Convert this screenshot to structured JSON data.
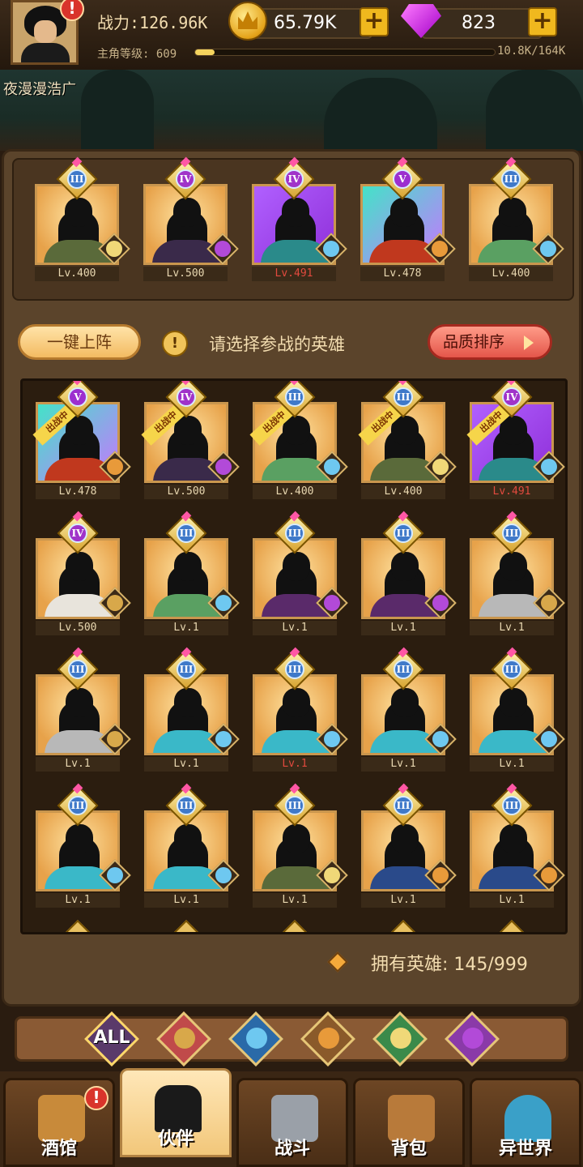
{
  "hud": {
    "power_label": "战力:126.96K",
    "level_label": "主角等级: 609",
    "exp_text": "10.8K/164K",
    "exp_fraction": 0.066,
    "gold": "65.79K",
    "gems": "823",
    "plus": "+",
    "alert": "!"
  },
  "scene": {
    "name": "夜漫漫浩广"
  },
  "lineup": [
    {
      "tier": "III",
      "level": "Lv.400",
      "red": false,
      "quality": "gold",
      "faction": "elf",
      "shoulder": "#5a6a3a"
    },
    {
      "tier": "IV",
      "level": "Lv.500",
      "red": false,
      "quality": "gold",
      "faction": "demon",
      "shoulder": "#3a2a4a"
    },
    {
      "tier": "IV",
      "level": "Lv.491",
      "red": true,
      "quality": "purple",
      "faction": "sea",
      "shoulder": "#2a8a8a"
    },
    {
      "tier": "V",
      "level": "Lv.478",
      "red": false,
      "quality": "rainbow",
      "faction": "beast",
      "shoulder": "#c0381e"
    },
    {
      "tier": "III",
      "level": "Lv.400",
      "red": false,
      "quality": "gold",
      "faction": "sea",
      "shoulder": "#5aa062"
    }
  ],
  "controls": {
    "auto_deploy": "一键上阵",
    "info_icon": "!",
    "hint": "请选择参战的英雄",
    "sort": "品质排序"
  },
  "roster": [
    {
      "tier": "V",
      "level": "Lv.478",
      "red": false,
      "quality": "rainbow",
      "faction": "beast",
      "shoulder": "#c0381e",
      "deployed": true
    },
    {
      "tier": "IV",
      "level": "Lv.500",
      "red": false,
      "quality": "gold",
      "faction": "demon",
      "shoulder": "#3a2a4a",
      "deployed": true
    },
    {
      "tier": "III",
      "level": "Lv.400",
      "red": false,
      "quality": "gold",
      "faction": "sea",
      "shoulder": "#5aa062",
      "deployed": true
    },
    {
      "tier": "III",
      "level": "Lv.400",
      "red": false,
      "quality": "gold",
      "faction": "elf",
      "shoulder": "#5a6a3a",
      "deployed": true
    },
    {
      "tier": "IV",
      "level": "Lv.491",
      "red": true,
      "quality": "purple",
      "faction": "sea",
      "shoulder": "#2a8a8a",
      "deployed": true
    },
    {
      "tier": "IV",
      "level": "Lv.500",
      "red": false,
      "quality": "gold",
      "faction": "human",
      "shoulder": "#e8e4dc",
      "deployed": false
    },
    {
      "tier": "III",
      "level": "Lv.1",
      "red": false,
      "quality": "gold",
      "faction": "sea",
      "shoulder": "#5aa062",
      "deployed": false
    },
    {
      "tier": "III",
      "level": "Lv.1",
      "red": false,
      "quality": "gold",
      "faction": "demon",
      "shoulder": "#5a2a6a",
      "deployed": false
    },
    {
      "tier": "III",
      "level": "Lv.1",
      "red": false,
      "quality": "gold",
      "faction": "demon",
      "shoulder": "#5a2a6a",
      "deployed": false
    },
    {
      "tier": "III",
      "level": "Lv.1",
      "red": false,
      "quality": "gold",
      "faction": "human",
      "shoulder": "#b8b8b8",
      "deployed": false
    },
    {
      "tier": "III",
      "level": "Lv.1",
      "red": false,
      "quality": "gold",
      "faction": "human",
      "shoulder": "#b8b8b8",
      "deployed": false
    },
    {
      "tier": "III",
      "level": "Lv.1",
      "red": false,
      "quality": "gold",
      "faction": "sea",
      "shoulder": "#3ab8c8",
      "deployed": false
    },
    {
      "tier": "III",
      "level": "Lv.1",
      "red": true,
      "quality": "gold",
      "faction": "sea",
      "shoulder": "#3ab8c8",
      "deployed": false
    },
    {
      "tier": "III",
      "level": "Lv.1",
      "red": false,
      "quality": "gold",
      "faction": "sea",
      "shoulder": "#3ab8c8",
      "deployed": false
    },
    {
      "tier": "III",
      "level": "Lv.1",
      "red": false,
      "quality": "gold",
      "faction": "sea",
      "shoulder": "#3ab8c8",
      "deployed": false
    },
    {
      "tier": "III",
      "level": "Lv.1",
      "red": false,
      "quality": "gold",
      "faction": "sea",
      "shoulder": "#3ab8c8",
      "deployed": false
    },
    {
      "tier": "III",
      "level": "Lv.1",
      "red": false,
      "quality": "gold",
      "faction": "sea",
      "shoulder": "#3ab8c8",
      "deployed": false
    },
    {
      "tier": "III",
      "level": "Lv.1",
      "red": false,
      "quality": "gold",
      "faction": "elf",
      "shoulder": "#5a6a3a",
      "deployed": false
    },
    {
      "tier": "III",
      "level": "Lv.1",
      "red": false,
      "quality": "gold",
      "faction": "beast",
      "shoulder": "#2a4a8a",
      "deployed": false
    },
    {
      "tier": "III",
      "level": "Lv.1",
      "red": false,
      "quality": "gold",
      "faction": "beast",
      "shoulder": "#2a4a8a",
      "deployed": false
    }
  ],
  "deployed_ribbon": "出战中",
  "owned": {
    "label": "拥有英雄:",
    "value": "145/999"
  },
  "filters": [
    {
      "id": "all",
      "label": "ALL",
      "bg": "#5a3a6a"
    },
    {
      "id": "human",
      "label": "",
      "bg": "#c04a4a"
    },
    {
      "id": "sea",
      "label": "",
      "bg": "#2a6aa8"
    },
    {
      "id": "beast",
      "label": "",
      "bg": "#8a5a2a"
    },
    {
      "id": "elf",
      "label": "",
      "bg": "#3a8a4a"
    },
    {
      "id": "demon",
      "label": "",
      "bg": "#8a3aa8"
    }
  ],
  "faction_colors": {
    "elf": "#f0d878",
    "demon": "#b24ad8",
    "sea": "#6ec8f0",
    "beast": "#e89a3a",
    "human": "#d8a84a"
  },
  "nav": [
    {
      "label": "酒馆",
      "icon": "tavern-icon",
      "active": false,
      "alert": true
    },
    {
      "label": "伙伴",
      "icon": "partner-icon",
      "active": true,
      "alert": false
    },
    {
      "label": "战斗",
      "icon": "battle-icon",
      "active": false,
      "alert": false
    },
    {
      "label": "背包",
      "icon": "backpack-icon",
      "active": false,
      "alert": false
    },
    {
      "label": "异世界",
      "icon": "portal-icon",
      "active": false,
      "alert": false
    }
  ]
}
